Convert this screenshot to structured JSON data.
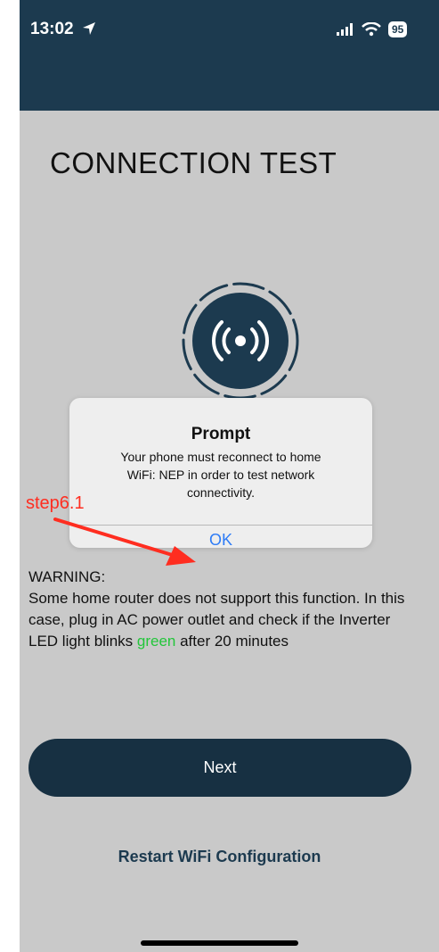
{
  "status_bar": {
    "time": "13:02",
    "battery": "95"
  },
  "page": {
    "title": "CONNECTION TEST"
  },
  "dialog": {
    "title": "Prompt",
    "message": "Your phone must reconnect to home WiFi: NEP in order to test network connectivity.",
    "ok_label": "OK"
  },
  "annotation": {
    "label": "step6.1"
  },
  "warning": {
    "heading": "WARNING:",
    "text_before": "Some home router does not support this function. In this case, plug in AC power outlet and check if the Inverter LED light blinks ",
    "highlight": "green",
    "text_after": " after 20 minutes"
  },
  "actions": {
    "next_label": "Next",
    "restart_label": "Restart WiFi Configuration"
  },
  "colors": {
    "header_bg": "#1c3a4f",
    "screen_bg": "#c9c9c9",
    "button_bg": "#173042",
    "link_blue": "#2e7cf6",
    "annotation_red": "#ff2d20",
    "highlight_green": "#22c63a"
  }
}
